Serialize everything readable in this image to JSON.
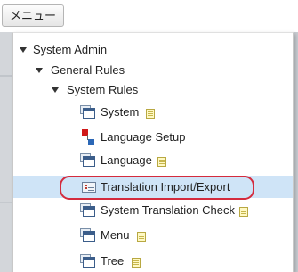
{
  "header": {
    "menu_button_label": "メニュー"
  },
  "tree": {
    "root": {
      "label": "System Admin"
    },
    "general_rules": {
      "label": "General Rules"
    },
    "system_rules": {
      "label": "System Rules"
    },
    "items": [
      {
        "label": "System",
        "icon": "window-icon",
        "note": true
      },
      {
        "label": "Language Setup",
        "icon": "language-setup-icon",
        "note": false
      },
      {
        "label": "Language",
        "icon": "window-icon",
        "note": true
      },
      {
        "label": "Translation Import/Export",
        "icon": "translation-icon",
        "note": false,
        "selected": true,
        "highlighted": true
      },
      {
        "label": "System Translation Check",
        "icon": "window-icon",
        "note": true
      },
      {
        "label": "Menu",
        "icon": "window-icon",
        "note": true
      },
      {
        "label": "Tree",
        "icon": "window-icon",
        "note": true
      }
    ]
  },
  "colors": {
    "highlight_ring": "#d42b3d",
    "selected_row": "#cfe4f7",
    "icon_blue": "#3b5d8a"
  }
}
